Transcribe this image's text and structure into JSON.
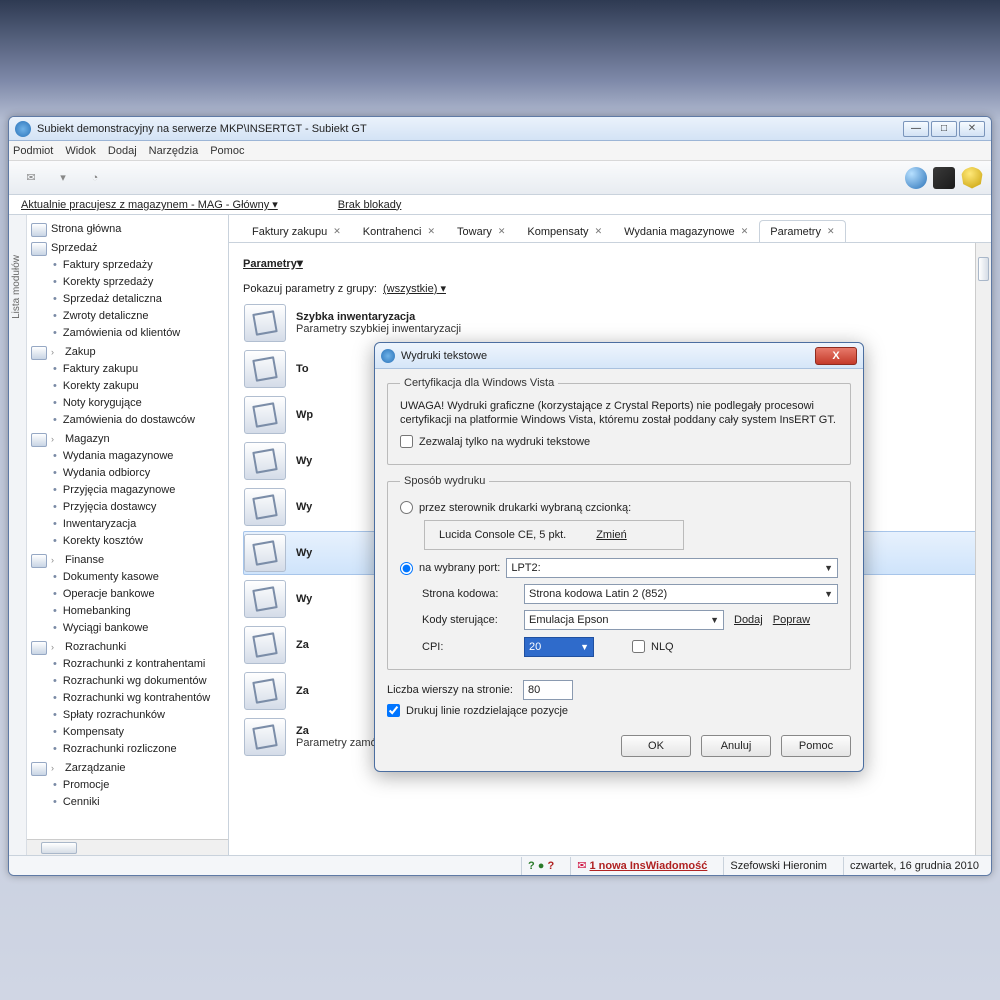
{
  "window": {
    "title": "Subiekt demonstracyjny na serwerze MKP\\INSERTGT - Subiekt GT"
  },
  "menu": [
    "Podmiot",
    "Widok",
    "Dodaj",
    "Narzędzia",
    "Pomoc"
  ],
  "infobar": {
    "warehouse": "Aktualnie pracujesz z magazynem - MAG - Główny ▾",
    "lock": "Brak blokady"
  },
  "sidebar": {
    "vlabel": "Lista modułów",
    "groups": [
      {
        "label": "Strona główna",
        "items": []
      },
      {
        "label": "Sprzedaż",
        "items": [
          "Faktury sprzedaży",
          "Korekty sprzedaży",
          "Sprzedaż detaliczna",
          "Zwroty detaliczne",
          "Zamówienia od klientów"
        ]
      },
      {
        "label": "Zakup",
        "items": [
          "Faktury zakupu",
          "Korekty zakupu",
          "Noty korygujące",
          "Zamówienia do dostawców"
        ]
      },
      {
        "label": "Magazyn",
        "items": [
          "Wydania magazynowe",
          "Wydania odbiorcy",
          "Przyjęcia magazynowe",
          "Przyjęcia dostawcy",
          "Inwentaryzacja",
          "Korekty kosztów"
        ]
      },
      {
        "label": "Finanse",
        "items": [
          "Dokumenty kasowe",
          "Operacje bankowe",
          "Homebanking",
          "Wyciągi bankowe"
        ]
      },
      {
        "label": "Rozrachunki",
        "items": [
          "Rozrachunki z kontrahentami",
          "Rozrachunki wg dokumentów",
          "Rozrachunki wg kontrahentów",
          "Spłaty rozrachunków",
          "Kompensaty",
          "Rozrachunki rozliczone"
        ]
      },
      {
        "label": "Zarządzanie",
        "items": [
          "Promocje",
          "Cenniki"
        ]
      }
    ]
  },
  "tabs": [
    "Faktury zakupu",
    "Kontrahenci",
    "Towary",
    "Kompensaty",
    "Wydania magazynowe",
    "Parametry"
  ],
  "active_tab": 5,
  "page": {
    "title": "Parametry",
    "filter_label": "Pokazuj parametry z grupy:",
    "filter_value": "(wszystkie) ▾",
    "items": [
      {
        "title": "Szybka inwentaryzacja",
        "sub": "Parametry szybkiej inwentaryzacji"
      },
      {
        "title": "To",
        "sub": ""
      },
      {
        "title": "Wp",
        "sub": ""
      },
      {
        "title": "Wy",
        "sub": ""
      },
      {
        "title": "Wy",
        "sub": ""
      },
      {
        "title": "Wy",
        "sub": ""
      },
      {
        "title": "Wy",
        "sub": ""
      },
      {
        "title": "Za",
        "sub": ""
      },
      {
        "title": "Za",
        "sub": ""
      },
      {
        "title": "Za",
        "sub": "Parametry zamówienia zaliczkowego od klienta"
      }
    ],
    "selected_index": 5
  },
  "dialog": {
    "title": "Wydruki tekstowe",
    "fs1_legend": "Certyfikacja dla Windows Vista",
    "warn": "UWAGA! Wydruki graficzne (korzystające z Crystal Reports) nie podlegały procesowi certyfikacji na platformie Windows Vista, któremu został poddany cały system InsERT GT.",
    "chk_text_only": "Zezwalaj tylko na wydruki tekstowe",
    "fs2_legend": "Sposób wydruku",
    "rad_font": "przez sterownik drukarki wybraną czcionką:",
    "font_value": "Lucida Console CE, 5 pkt.",
    "font_change": "Zmień",
    "rad_port": "na wybrany port:",
    "port_value": "LPT2:",
    "codepage_label": "Strona kodowa:",
    "codepage_value": "Strona kodowa Latin 2 (852)",
    "codes_label": "Kody sterujące:",
    "codes_value": "Emulacja Epson",
    "codes_add": "Dodaj",
    "codes_fix": "Popraw",
    "cpi_label": "CPI:",
    "cpi_value": "20",
    "nlq": "NLQ",
    "rows_label": "Liczba wierszy na stronie:",
    "rows_value": "80",
    "chk_lines": "Drukuj linie rozdzielające pozycje",
    "btn_ok": "OK",
    "btn_cancel": "Anuluj",
    "btn_help": "Pomoc"
  },
  "status": {
    "msg": "1 nowa InsWiadomość",
    "user": "Szefowski Hieronim",
    "date": "czwartek, 16 grudnia 2010"
  }
}
